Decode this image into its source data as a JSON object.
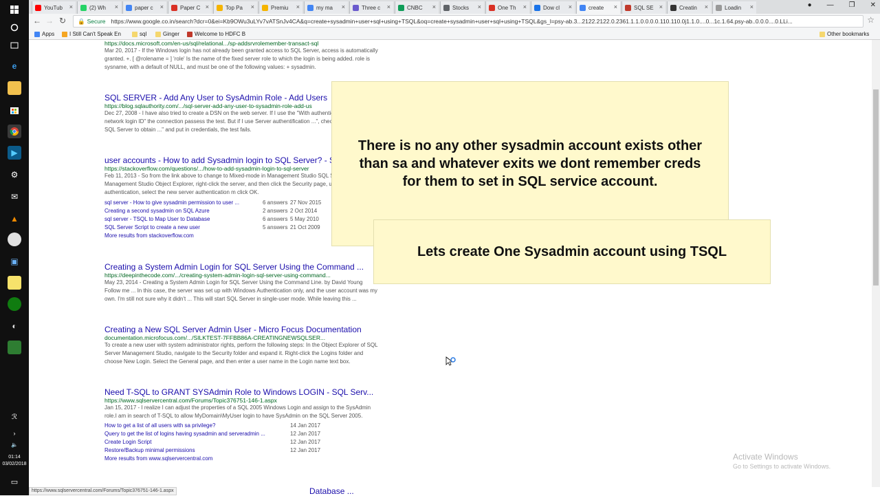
{
  "taskbar": {
    "icons": [
      "windows-start-icon",
      "cortana-icon",
      "task-view-icon",
      "edge-icon",
      "file-explorer-icon",
      "store-icon",
      "chrome-icon",
      "visual-studio-icon",
      "settings-icon",
      "mail-icon",
      "vlc-icon",
      "chrome-canary-icon",
      "network-icon",
      "sticky-notes-icon",
      "xbox-icon",
      "paint-icon",
      "app-icon"
    ],
    "time": "01:14",
    "date": "03/02/2018"
  },
  "tabs": [
    {
      "label": "YouTub",
      "color": "#ff0000"
    },
    {
      "label": "(2) Wh",
      "color": "#25d366"
    },
    {
      "label": "paper c",
      "color": "#4285f4"
    },
    {
      "label": "Paper C",
      "color": "#d93025"
    },
    {
      "label": "Top Pa",
      "color": "#f5b400"
    },
    {
      "label": "Premiu",
      "color": "#f5b400"
    },
    {
      "label": "my ma",
      "color": "#4285f4"
    },
    {
      "label": "Three c",
      "color": "#6a5acd"
    },
    {
      "label": "CNBC",
      "color": "#0f9d58"
    },
    {
      "label": "Stocks",
      "color": "#5f6368"
    },
    {
      "label": "One Th",
      "color": "#d93025"
    },
    {
      "label": "Dow cl",
      "color": "#1a73e8"
    },
    {
      "label": "create",
      "color": "#4285f4",
      "active": true
    },
    {
      "label": "SQL SE",
      "color": "#c0392b"
    },
    {
      "label": "Creatin",
      "color": "#333333"
    },
    {
      "label": "Loadin",
      "color": "#999999"
    }
  ],
  "address": {
    "secure_label": "Secure",
    "url": "https://www.google.co.in/search?dcr=0&ei=Kb9OWu3uLYv7vATSnJv4CA&q=create+sysadmin+user+sql+using+TSQL&oq=create+sysadmin+user+sql+using+TSQL&gs_l=psy-ab.3...2122.2122.0.2361.1.1.0.0.0.0.110.110.0j1.1.0....0...1c.1.64.psy-ab..0.0.0....0.LLi..."
  },
  "bookmarks": {
    "apps": "Apps",
    "items": [
      "I Still Can't Speak En",
      "sql",
      "Ginger",
      "Welcome to HDFC B"
    ],
    "other": "Other bookmarks"
  },
  "results": [
    {
      "url": "https://docs.microsoft.com/en-us/sql/relational.../sp-addsrvrolemember-transact-sql",
      "snippet": "Mar 20, 2017 - If the Windows login has not already been granted access to SQL Server, access is automatically granted. +. [ @rolename = ] 'role' Is the name of the fixed server role to which the login is being added. role is sysname, with a default of NULL, and must be one of the following values: + sysadmin."
    },
    {
      "title": "SQL SERVER - Add Any User to SysAdmin Role - Add Users",
      "url": "https://blog.sqlauthority.com/.../sql-server-add-any-user-to-sysadmin-role-add-us",
      "snippet": "Dec 27, 2008 - I have also tried to create a DSN on the web server. If I use the \"With authentication using the network login ID\" the connection passess the test. But if I use Server authentification ...\", check the \"Connect to SQL Server to obtain ...\" and put in credentials, the test fails."
    },
    {
      "title": "user accounts - How to add Sysadmin login to SQL Server? - S",
      "url": "https://stackoverflow.com/questions/.../how-to-add-sysadmin-login-to-sql-server",
      "snippet": "Feb 11, 2013 - So from the link above to change to Mixed-mode in Management Studio SQL Server Management Studio Object Explorer, right-click the server, and then click the Security page, under Server authentication, select the new server authentication m click OK.",
      "subs": [
        {
          "label": "sql server - How to give sysadmin permission to user ...",
          "count": "6 answers",
          "date": "27 Nov 2015"
        },
        {
          "label": "Creating a second sysadmin on SQL Azure",
          "count": "2 answers",
          "date": "2 Oct 2014"
        },
        {
          "label": "sql server - TSQL to Map User to Database",
          "count": "6 answers",
          "date": "5 May 2010"
        },
        {
          "label": "SQL Server Script to create a new user",
          "count": "5 answers",
          "date": "21 Oct 2009"
        }
      ],
      "more": "More results from stackoverflow.com"
    },
    {
      "title": "Creating a System Admin Login for SQL Server Using the Command ...",
      "url": "https://deepinthecode.com/.../creating-system-admin-login-sql-server-using-command...",
      "snippet": "May 23, 2014 - Creating a System Admin Login for SQL Server Using the Command Line. by David Young Follow me ... In this case, the server was set up with Windows Authentication only, and the user account was my own. I'm still not sure why it didn't ... This will start SQL Server in single-user mode. While leaving this ..."
    },
    {
      "title": "Creating a New SQL Server Admin User - Micro Focus Documentation",
      "url": "documentation.microfocus.com/.../SILKTEST-7FFBB86A-CREATINGNEWSQLSER...",
      "snippet": "To create a new user with system administrator rights, perform the following steps: In the Object Explorer of SQL Server Management Studio, navigate to the Security folder and expand it. Right-click the Logins folder and choose New Login. Select the General page, and then enter a user name in the Login name text box."
    },
    {
      "title": "Need T-SQL to GRANT SYSAdmin Role to Windows LOGIN - SQL Serv...",
      "url": "https://www.sqlservercentral.com/Forums/Topic376751-146-1.aspx",
      "snippet": "Jan 15, 2017 - I realize I can adjust the properties of a SQL 2005 Windows Login and assign to the SysAdmin role.I am in search of T-SQL to allow MyDomain\\MyUser login to have SysAdmin on the SQL Server 2005.",
      "subs": [
        {
          "label": "How to get a list of all users with sa privilege?",
          "count": "",
          "date": "14 Jan 2017"
        },
        {
          "label": "Query to get the list of logins having sysadmin and serveradmin ...",
          "count": "",
          "date": "12 Jan 2017"
        },
        {
          "label": "Create Login Script",
          "count": "",
          "date": "12 Jan 2017"
        },
        {
          "label": "Restore/Backup minimal permissions",
          "count": "",
          "date": "12 Jan 2017"
        }
      ],
      "more": "More results from www.sqlservercentral.com"
    }
  ],
  "callouts": {
    "first": "There is no any other sysadmin account exists other than sa  and whatever exits we dont remember creds for them to set in SQL service account.",
    "second": "Lets create One Sysadmin account using TSQL"
  },
  "watermark": {
    "line1": "Activate Windows",
    "line2": "Go to Settings to activate Windows."
  },
  "status_url": "https://www.sqlservercentral.com/Forums/Topic376751-146-1.aspx",
  "bottom_peek": "Database ..."
}
